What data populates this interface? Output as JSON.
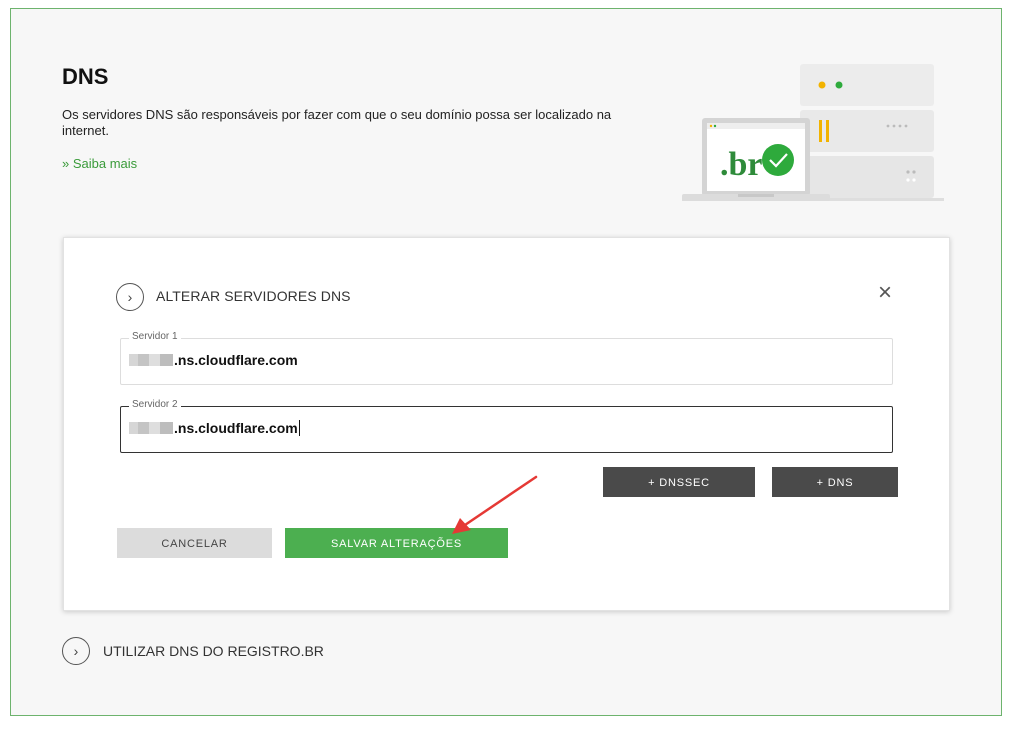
{
  "header": {
    "title": "DNS",
    "description": "Os servidores DNS são responsáveis por fazer com que o seu domínio possa ser localizado na internet.",
    "learn_more": "» Saiba mais",
    "illustration_text": ".br"
  },
  "card": {
    "section_title": "ALTERAR SERVIDORES DNS",
    "close_icon": "×",
    "expand_icon": "›",
    "fields": [
      {
        "label": "Servidor 1",
        "value": ".ns.cloudflare.com"
      },
      {
        "label": "Servidor 2",
        "value": ".ns.cloudflare.com"
      }
    ],
    "buttons": {
      "dnssec": "+ DNSSEC",
      "dns": "+ DNS",
      "cancel": "CANCELAR",
      "save": "SALVAR ALTERAÇÕES"
    }
  },
  "bottom_section": {
    "title": "UTILIZAR DNS DO REGISTRO.BR",
    "expand_icon": "›"
  },
  "colors": {
    "frame_border": "#6db36d",
    "accent_green": "#4caf50",
    "link_green": "#3a9b3a",
    "dark_button": "#4a4a4a",
    "annotation_red": "#e53935"
  }
}
